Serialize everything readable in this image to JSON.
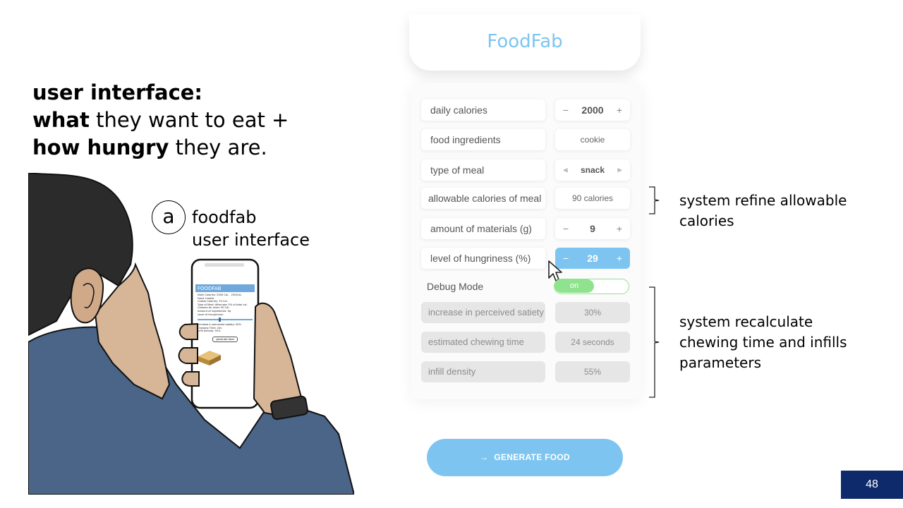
{
  "slide": {
    "headline": {
      "line1_bold": "user interface:",
      "line2_bold": "what",
      "line2_rest": " they want to eat +",
      "line3_bold": "how hungry",
      "line3_rest": " they are."
    },
    "badge_letter": "a",
    "badge_caption_line1": "foodfab",
    "badge_caption_line2": "user interface",
    "page_number": "48"
  },
  "phone": {
    "header": "FOODFAB",
    "lines": [
      "Daily Calories: 2000 Cal. - 230/Cal.",
      "Food: Cookie",
      "Cookie Calories: 70 Cal.",
      "Type of Meal: Afternoon 5% of total cal.",
      "Calories for meal: 90 Cal.",
      "Amount of Ingredients: 9g",
      "Level of Hungriness:",
      "Increase in perceived satiety: 30%",
      "Chewing Time: 24s",
      "Infill Density: 55%"
    ],
    "button": "generate food"
  },
  "app": {
    "title": "FoodFab",
    "fields": [
      {
        "label": "daily calories",
        "value": "2000",
        "minus": "−",
        "plus": "+"
      },
      {
        "label": "food ingredients",
        "value": "cookie"
      },
      {
        "label": "type of meal",
        "value": "snack",
        "prev": "⪡",
        "next": "⪢"
      },
      {
        "label": "allowable calories of meal",
        "value": "90 calories"
      },
      {
        "label": "amount of materials (g)",
        "value": "9",
        "minus": "−",
        "plus": "+"
      },
      {
        "label": "level of hungriness (%)",
        "value": "29",
        "minus": "−",
        "plus": "+"
      }
    ],
    "debug": {
      "label": "Debug Mode",
      "toggle": "on",
      "rows": [
        {
          "label": "increase in perceived satiety",
          "value": "30%"
        },
        {
          "label": "estimated chewing time",
          "value": "24 seconds"
        },
        {
          "label": "infill density",
          "value": "55%"
        }
      ]
    },
    "generate_button": "GENERATE FOOD",
    "generate_arrow": "→"
  },
  "annotations": {
    "refine": [
      "system refine allowable",
      "calories"
    ],
    "recalc": [
      "system recalculate",
      "chewing time and infills",
      "parameters"
    ]
  },
  "colors": {
    "accent": "#7dc5f0",
    "toggle": "#8fe38f",
    "page_badge": "#0f2a6b"
  }
}
